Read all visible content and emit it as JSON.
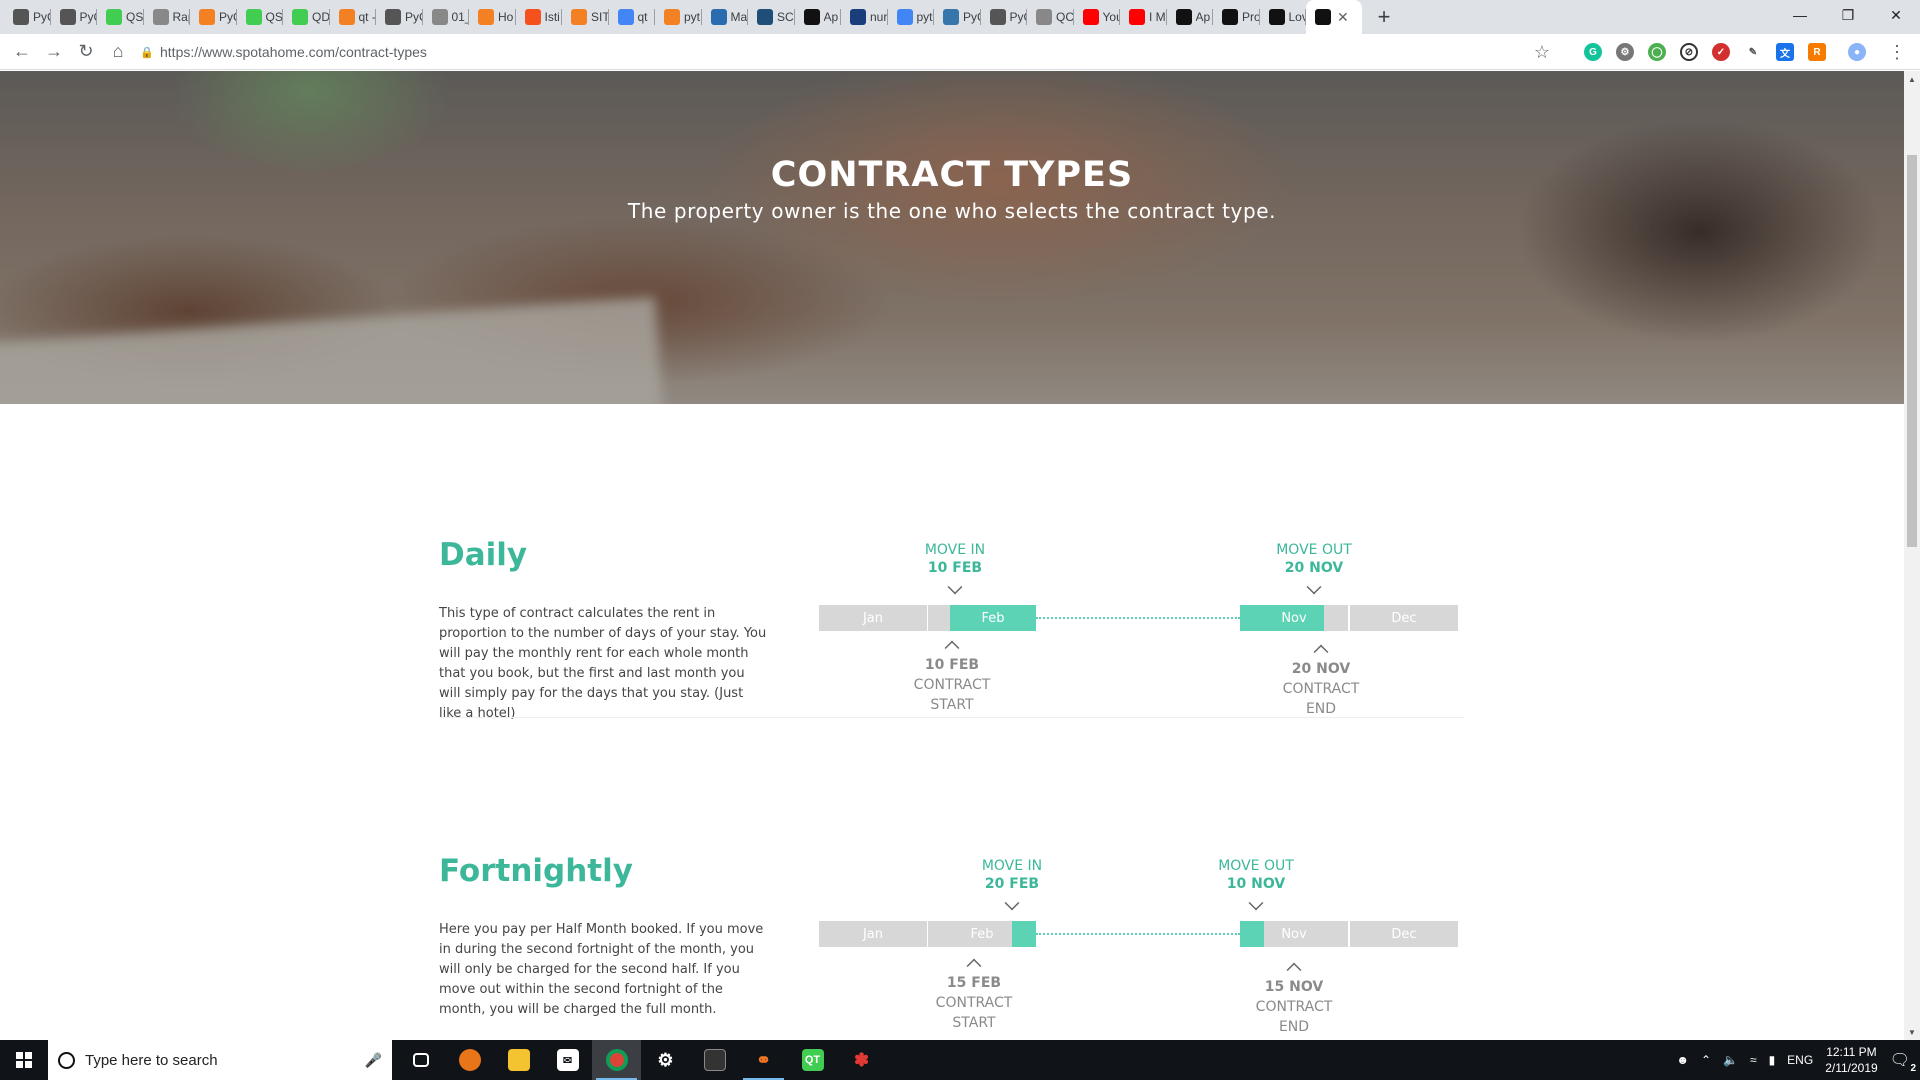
{
  "browser": {
    "tabs": [
      {
        "title": "PyC",
        "icon": "pycharm-icon",
        "color": "#555"
      },
      {
        "title": "PyC",
        "icon": "pycharm-icon",
        "color": "#555"
      },
      {
        "title": "QS",
        "icon": "qt-icon",
        "color": "#41cd52"
      },
      {
        "title": "Rap",
        "icon": "doc-icon",
        "color": "#888"
      },
      {
        "title": "PyC",
        "icon": "stackoverflow-icon",
        "color": "#f48024"
      },
      {
        "title": "QS",
        "icon": "qt-doc-icon",
        "color": "#41cd52"
      },
      {
        "title": "QD",
        "icon": "qt-designer-icon",
        "color": "#41cd52"
      },
      {
        "title": "qt -",
        "icon": "stackoverflow-icon",
        "color": "#f48024"
      },
      {
        "title": "PyC",
        "icon": "pycharm-icon",
        "color": "#555"
      },
      {
        "title": "01_",
        "icon": "doc-icon",
        "color": "#888"
      },
      {
        "title": "Ho",
        "icon": "stackoverflow-icon",
        "color": "#f48024"
      },
      {
        "title": "Isti",
        "icon": "loading-icon",
        "color": "#f4511e"
      },
      {
        "title": "SIT",
        "icon": "sublime-icon",
        "color": "#f48024"
      },
      {
        "title": "qt",
        "icon": "google-icon",
        "color": "#4285f4"
      },
      {
        "title": "pyt",
        "icon": "stackoverflow-icon",
        "color": "#f48024"
      },
      {
        "title": "Ma",
        "icon": "qt-icon",
        "color": "#2b6cb0"
      },
      {
        "title": "SCI",
        "icon": "scipy-icon",
        "color": "#1f4e79"
      },
      {
        "title": "Ap",
        "icon": "codepen-icon",
        "color": "#111"
      },
      {
        "title": "nur",
        "icon": "sympy-icon",
        "color": "#1a3d7c"
      },
      {
        "title": "pyt",
        "icon": "google-icon",
        "color": "#4285f4"
      },
      {
        "title": "PyC",
        "icon": "python-icon",
        "color": "#3776ab"
      },
      {
        "title": "PyC",
        "icon": "pycharm-icon",
        "color": "#555"
      },
      {
        "title": "QC",
        "icon": "doc-icon",
        "color": "#888"
      },
      {
        "title": "You",
        "icon": "youtube-icon",
        "color": "#ff0000"
      },
      {
        "title": "I M",
        "icon": "youtube-icon",
        "color": "#ff0000"
      },
      {
        "title": "Ap",
        "icon": "codepen-icon",
        "color": "#111"
      },
      {
        "title": "Pro",
        "icon": "codepen-icon",
        "color": "#111"
      },
      {
        "title": "Lov",
        "icon": "codepen-icon",
        "color": "#111"
      }
    ],
    "url": "https://www.spotahome.com/contract-types"
  },
  "hero": {
    "title": "CONTRACT TYPES",
    "subtitle": "The property owner is the one who selects the contract type."
  },
  "sections": [
    {
      "title": "Daily",
      "description": "This type of contract calculates the rent in proportion to the number of days of your stay. You will pay the monthly rent for each whole month that you book, but the first and last month you will simply pay for the days that you stay. (Just like a hotel)",
      "months": [
        "Jan",
        "Feb",
        "Nov",
        "Dec"
      ],
      "move_in_label": "MOVE IN",
      "move_in_date": "10 FEB",
      "move_out_label": "MOVE OUT",
      "move_out_date": "20 NOV",
      "contract_start_date": "10 FEB",
      "contract_start_l1": "CONTRACT",
      "contract_start_l2": "START",
      "contract_end_date": "20 NOV",
      "contract_end_l1": "CONTRACT",
      "contract_end_l2": "END"
    },
    {
      "title": "Fortnightly",
      "description": "Here you pay per Half Month booked. If you move in during the second fortnight of the month, you will only be charged for the second half. If you move out within the second fortnight of the month, you will be charged the full month.",
      "months": [
        "Jan",
        "Feb",
        "Nov",
        "Dec"
      ],
      "move_in_label": "MOVE IN",
      "move_in_date": "20 FEB",
      "move_out_label": "MOVE OUT",
      "move_out_date": "10 NOV",
      "contract_start_date": "15 FEB",
      "contract_start_l1": "CONTRACT",
      "contract_start_l2": "START",
      "contract_end_date": "15 NOV",
      "contract_end_l1": "CONTRACT",
      "contract_end_l2": "END"
    }
  ],
  "taskbar": {
    "search_placeholder": "Type here to search",
    "language": "ENG",
    "time": "12:11 PM",
    "date": "2/11/2019",
    "notification_count": "2"
  },
  "colors": {
    "accent": "#3db79a",
    "timeline_fill": "#5dd3b6",
    "timeline_empty": "#d7d7d7"
  }
}
